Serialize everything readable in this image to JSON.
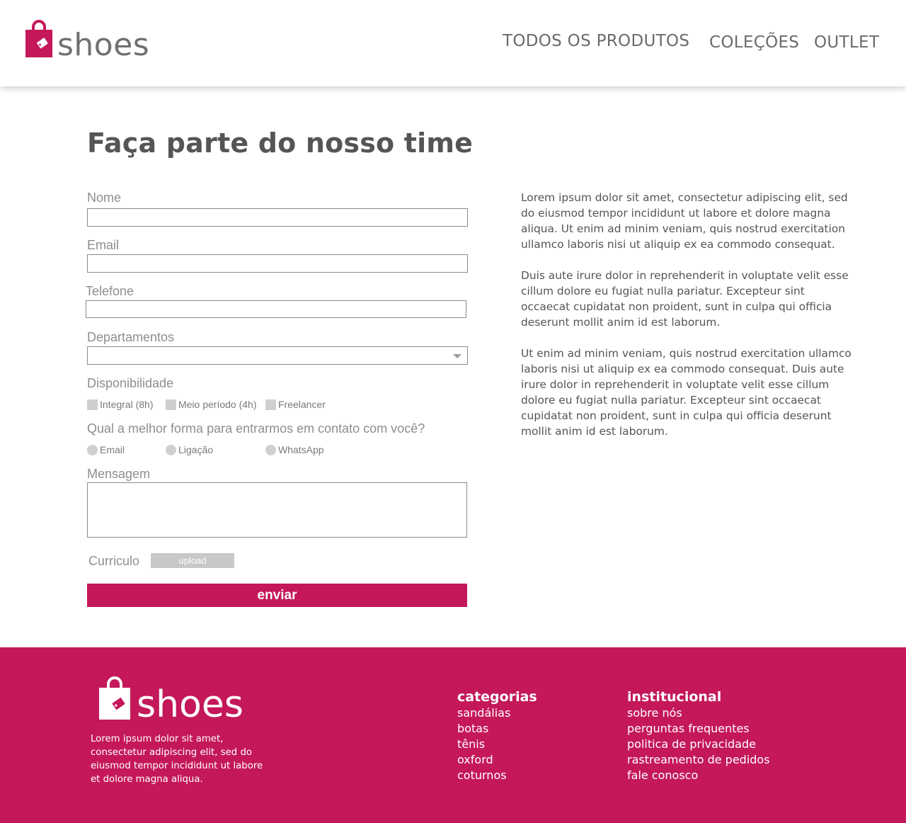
{
  "header": {
    "brand": "shoes",
    "nav": [
      "TODOS OS PRODUTOS",
      "COLEÇÕES",
      "OUTLET"
    ]
  },
  "colors": {
    "accent": "#c4185a",
    "text": "#555555",
    "label": "#8e8e8e",
    "control": "#cfcfcf"
  },
  "form": {
    "title": "Faça parte do nosso time",
    "name_label": "Nome",
    "name_value": "",
    "email_label": "Email",
    "email_value": "",
    "phone_label": "Telefone",
    "phone_value": "",
    "department_label": "Departamentos",
    "department_value": "",
    "availability_label": "Disponibilidade",
    "availability_options": [
      "Integral (8h)",
      "Meio período (4h)",
      "Freelancer"
    ],
    "contact_label": "Qual a melhor forma para entrarmos em contato com você?",
    "contact_options": [
      "Email",
      "Ligação",
      "WhatsApp"
    ],
    "message_label": "Mensagem",
    "message_value": "",
    "resume_label": "Curriculo",
    "upload_label": "upload",
    "submit_label": "enviar"
  },
  "content": {
    "paragraphs": [
      "Lorem ipsum dolor sit amet, consectetur adipiscing elit, sed do eiusmod tempor incididunt ut labore et dolore magna aliqua. Ut enim ad minim veniam, quis nostrud exercitation ullamco laboris nisi ut aliquip ex ea commodo consequat.",
      "Duis aute irure dolor in reprehenderit in voluptate velit esse cillum dolore eu fugiat nulla pariatur. Excepteur sint occaecat cupidatat non proident, sunt in culpa qui officia deserunt mollit anim id est laborum.",
      "Ut enim ad minim veniam, quis nostrud exercitation ullamco laboris nisi ut aliquip ex ea commodo consequat. Duis aute irure dolor in reprehenderit in voluptate velit esse cillum dolore eu fugiat nulla pariatur. Excepteur sint occaecat cupidatat non proident, sunt in culpa qui officia deserunt mollit anim id est laborum."
    ]
  },
  "footer": {
    "brand": "shoes",
    "description": "Lorem ipsum dolor sit amet, consectetur adipiscing elit, sed do eiusmod tempor incididunt ut labore et dolore magna aliqua.",
    "categories_title": "categorias",
    "categories": [
      "sandálias",
      "botas",
      "tênis",
      "oxford",
      "coturnos"
    ],
    "institutional_title": "institucional",
    "institutional": [
      "sobre nós",
      "perguntas frequentes",
      "politica de privacidade",
      "rastreamento de pedidos",
      "fale conosco"
    ]
  }
}
